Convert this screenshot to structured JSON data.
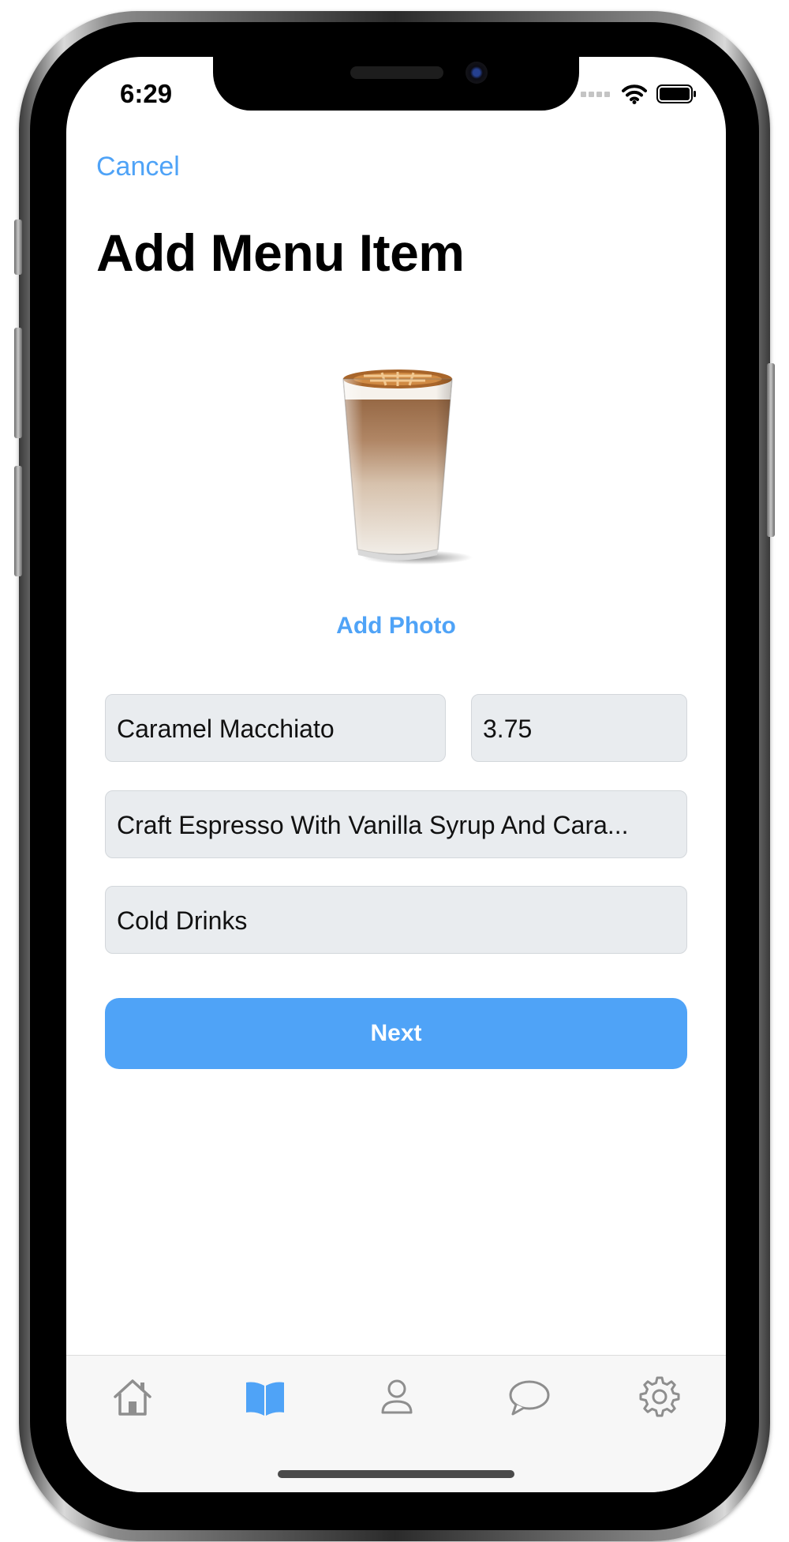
{
  "status_bar": {
    "time": "6:29",
    "icons": [
      "signal-icon",
      "wifi-icon",
      "battery-icon"
    ]
  },
  "nav": {
    "cancel_label": "Cancel"
  },
  "page": {
    "title": "Add Menu Item"
  },
  "photo": {
    "image_name": "caramel-macchiato-image",
    "add_photo_label": "Add Photo"
  },
  "form": {
    "name_value": "Caramel Macchiato",
    "price_value": "3.75",
    "description_value": "Craft Espresso With Vanilla Syrup And Cara...",
    "category_value": "Cold Drinks"
  },
  "actions": {
    "next_label": "Next"
  },
  "tabbar": {
    "tabs": [
      {
        "icon": "home-icon",
        "active": false
      },
      {
        "icon": "book-icon",
        "active": true
      },
      {
        "icon": "person-icon",
        "active": false
      },
      {
        "icon": "chat-bubble-icon",
        "active": false
      },
      {
        "icon": "gear-icon",
        "active": false
      }
    ]
  },
  "colors": {
    "accent": "#4fa3f7",
    "field_background": "#e9ecef",
    "tab_inactive": "#8e8e8e"
  }
}
